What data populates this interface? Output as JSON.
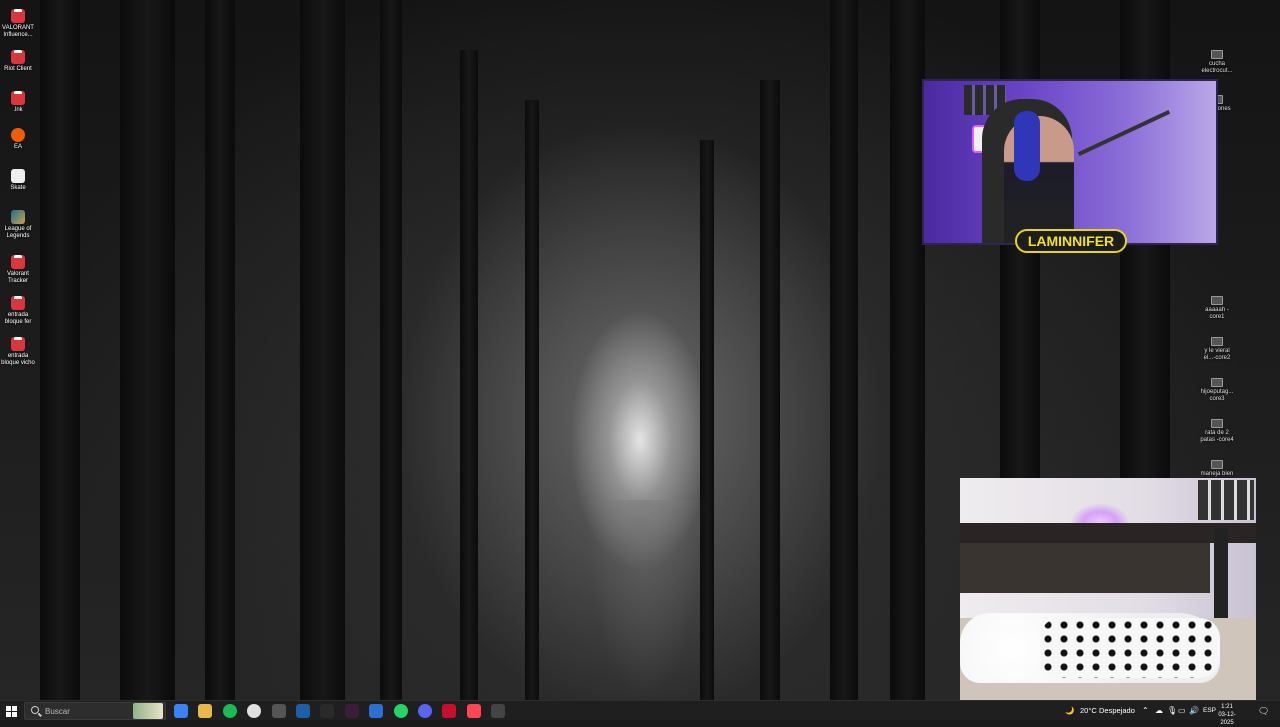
{
  "desktop": {
    "left_icons": [
      {
        "label": "VALORANT Influence...",
        "icon": "riot-app-icon"
      },
      {
        "label": "Riot Client",
        "icon": "riot-client-icon"
      },
      {
        "label": ".lnk",
        "icon": "riot-shortcut-icon"
      },
      {
        "label": "EA",
        "icon": "ea-icon"
      },
      {
        "label": "Skate",
        "icon": "skate-icon"
      },
      {
        "label": "League of Legends",
        "icon": "league-of-legends-icon"
      },
      {
        "label": "Valorant Tracker",
        "icon": "valorant-tracker-icon"
      },
      {
        "label": "entrada bloque fer",
        "icon": "pdf-file-icon"
      },
      {
        "label": "entrada bloque vicho",
        "icon": "pdf-file-icon"
      }
    ],
    "right_icons": [
      {
        "label": "cucha electrocut...",
        "icon": "media-file-icon"
      },
      {
        "label": "iano iones",
        "icon": "media-file-icon"
      },
      {
        "label": "aaaaah - core1",
        "icon": "media-file-icon"
      },
      {
        "label": "y le vieral el...-core2",
        "icon": "media-file-icon"
      },
      {
        "label": "hijoeputag... core3",
        "icon": "media-file-icon"
      },
      {
        "label": "rata de 2 patas -core4",
        "icon": "media-file-icon"
      },
      {
        "label": "maneja bien",
        "icon": "media-file-icon"
      }
    ]
  },
  "overlay": {
    "streamer_name": "LAMINNIFER"
  },
  "taskbar": {
    "search_placeholder": "Buscar",
    "pinned": [
      {
        "icon": "copilot-icon",
        "color": "#3b82f6"
      },
      {
        "icon": "file-explorer-icon",
        "color": "#e8b84a"
      },
      {
        "icon": "spotify-icon",
        "color": "#1db954"
      },
      {
        "icon": "chrome-icon",
        "color": "#e0e0e0"
      },
      {
        "icon": "calculator-icon",
        "color": "#555555"
      },
      {
        "icon": "steam-icon",
        "color": "#1b5fa8"
      },
      {
        "icon": "media-player-icon",
        "color": "#2a2a2a"
      },
      {
        "icon": "epic-games-icon",
        "color": "#3a1d3a"
      },
      {
        "icon": "ccleaner-icon",
        "color": "#2f6fd1"
      },
      {
        "icon": "whatsapp-icon",
        "color": "#25d366"
      },
      {
        "icon": "discord-icon",
        "color": "#5865f2"
      },
      {
        "icon": "riot-taskbar-icon",
        "color": "#c8102e"
      },
      {
        "icon": "valorant-icon",
        "color": "#ff4655"
      },
      {
        "icon": "obs-icon",
        "color": "#444444"
      }
    ],
    "weather": {
      "temp": "20°C",
      "condition": "Despejado"
    },
    "language": "ESP",
    "time": "1:21",
    "date": "03-12-2025"
  }
}
